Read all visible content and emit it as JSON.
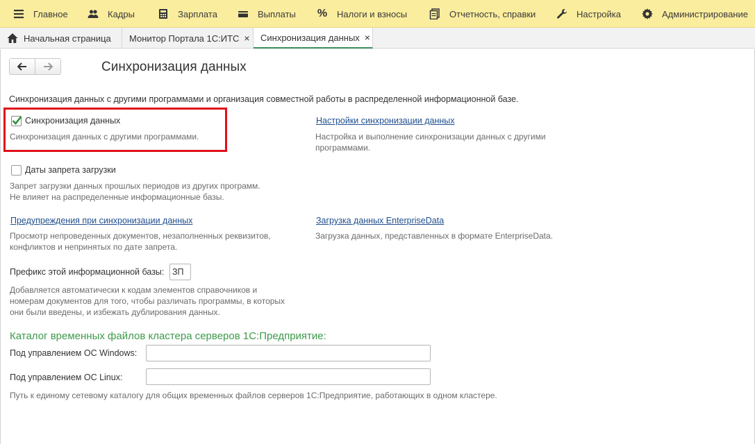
{
  "menu": {
    "items": [
      {
        "label": "Главное",
        "icon": "hamburger-icon"
      },
      {
        "label": "Кадры",
        "icon": "people-icon"
      },
      {
        "label": "Зарплата",
        "icon": "calculator-icon"
      },
      {
        "label": "Выплаты",
        "icon": "wallet-icon"
      },
      {
        "label": "Налоги и взносы",
        "icon": "percent-icon"
      },
      {
        "label": "Отчетность, справки",
        "icon": "documents-icon"
      },
      {
        "label": "Настройка",
        "icon": "wrench-icon"
      },
      {
        "label": "Администрирование",
        "icon": "gear-icon"
      }
    ]
  },
  "tabs": {
    "home": "Начальная страница",
    "its": "Монитор Портала 1С:ИТС",
    "sync": "Синхронизация данных",
    "close_glyph": "×"
  },
  "page": {
    "title": "Синхронизация данных",
    "description": "Синхронизация данных с другими программами и организация совместной работы в распределенной информационной базе."
  },
  "sync": {
    "checkbox_label": "Синхронизация данных",
    "checked": true,
    "hint": "Синхронизация данных с другими программами."
  },
  "sync_settings": {
    "link": "Настройки синхронизации данных",
    "hint1": "Настройка и выполнение синхронизации данных с другими",
    "hint2": "программами."
  },
  "load_ban": {
    "checkbox_label": "Даты запрета загрузки",
    "checked": false,
    "hint1": "Запрет загрузки данных прошлых периодов из других программ.",
    "hint2": "Не влияет на распределенные информационные базы."
  },
  "warnings": {
    "link": "Предупреждения при синхронизации данных",
    "hint1": "Просмотр непроведенных документов, незаполненных реквизитов,",
    "hint2": "конфликтов и непринятых по дате запрета."
  },
  "enterprise_data": {
    "link": "Загрузка данных EnterpriseData",
    "hint": "Загрузка данных, представленных в формате EnterpriseData."
  },
  "prefix": {
    "label": "Префикс этой информационной базы:",
    "value": "ЗП",
    "hint1": "Добавляется автоматически к кодам элементов справочников и",
    "hint2": "номерам документов для того, чтобы различать программы, в которых",
    "hint3": "они были введены, и избежать дублирования данных."
  },
  "cluster": {
    "heading": "Каталог временных файлов кластера серверов 1С:Предприятие:",
    "windows_label": "Под управлением ОС Windows:",
    "windows_value": "",
    "linux_label": "Под управлением ОС Linux:",
    "linux_value": "",
    "hint": "Путь к единому сетевому каталогу для общих временных файлов серверов 1С:Предприятие, работающих в одном кластере."
  },
  "colors": {
    "menu_bg": "#fbed9e",
    "link": "#1f4f8f",
    "heading_green": "#3d9a4a",
    "highlight_red": "#e0101a",
    "check_green": "#2f8f3a"
  }
}
